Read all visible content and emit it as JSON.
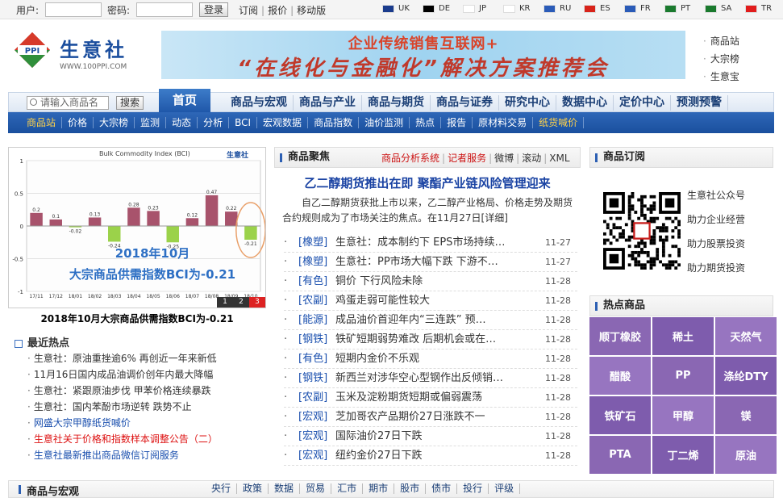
{
  "topbar": {
    "username_label": "用户:",
    "password_label": "密码:",
    "login_button": "登录",
    "links": [
      "订阅",
      "报价",
      "移动版"
    ],
    "languages": [
      {
        "code": "UK",
        "flag_color": "#1a3b8c"
      },
      {
        "code": "DE",
        "flag_color": "#000000"
      },
      {
        "code": "JP",
        "flag_color": "#ffffff"
      },
      {
        "code": "KR",
        "flag_color": "#ffffff"
      },
      {
        "code": "RU",
        "flag_color": "#2a5bb8"
      },
      {
        "code": "ES",
        "flag_color": "#d8231a"
      },
      {
        "code": "FR",
        "flag_color": "#2a5bb8"
      },
      {
        "code": "PT",
        "flag_color": "#1a7a2e"
      },
      {
        "code": "SA",
        "flag_color": "#1a7a2e"
      },
      {
        "code": "TR",
        "flag_color": "#e11c1c"
      }
    ]
  },
  "logo": {
    "name": "生意社",
    "url": "WWW.100PPI.COM",
    "mark": "PPI"
  },
  "banner": {
    "line1": "企业传统销售互联网+",
    "line2": "“在线化与金融化”解决方案推荐会"
  },
  "right_links": [
    "商品站",
    "大宗榜",
    "生意宝"
  ],
  "search": {
    "placeholder": "请输入商品名",
    "button": "搜索"
  },
  "main_nav": {
    "home": "首页",
    "items": [
      "商品与宏观",
      "商品与产业",
      "商品与期货",
      "商品与证券",
      "研究中心",
      "数据中心",
      "定价中心",
      "预测预警"
    ]
  },
  "sub_nav": {
    "items": [
      "商品站",
      "价格",
      "大宗榜",
      "监测",
      "动态",
      "分析",
      "BCI",
      "宏观数据",
      "商品指数",
      "油价监测",
      "热点",
      "报告",
      "原材料交易",
      "纸货喊价"
    ],
    "highlighted": [
      "商品站",
      "纸货喊价"
    ]
  },
  "chart_data": {
    "type": "bar",
    "title": "Bulk Commodity Index (BCI)",
    "categories": [
      "17/11",
      "17/12",
      "18/01",
      "18/02",
      "18/03",
      "18/04",
      "18/05",
      "18/06",
      "18/07",
      "18/08",
      "18/09",
      "18/10"
    ],
    "values": [
      0.2,
      0.1,
      -0.02,
      0.13,
      -0.24,
      0.28,
      0.23,
      -0.25,
      0.12,
      0.47,
      0.22,
      -0.21
    ],
    "ylim": [
      -1,
      1
    ],
    "yticks": [
      1,
      0.5,
      0,
      -0.5,
      -1
    ],
    "overlay_text": [
      "2018年10月",
      "大宗商品供需指数BCI为-0.21"
    ],
    "pages": [
      "1",
      "2",
      "3"
    ],
    "active_page": "3",
    "pos_color": "#a8536c",
    "neg_color": "#9bd24a"
  },
  "chart_caption": "2018年10月大宗商品供需指数BCI为-0.21",
  "hot": {
    "title": "最近热点",
    "items": [
      {
        "text": "生意社：原油重挫逾6% 再创近一年来新低",
        "style": "normal"
      },
      {
        "text": "11月16日国内成品油调价创年内最大降幅",
        "style": "normal"
      },
      {
        "text": "生意社：紧跟原油步伐 甲苯价格连续暴跌",
        "style": "normal"
      },
      {
        "text": "生意社：国内苯酚市场逆转 跌势不止",
        "style": "normal"
      },
      {
        "text": "网盛大宗甲醇纸货喊价",
        "style": "blue"
      },
      {
        "text": "生意社关于价格和指数样本调整公告（二）",
        "style": "red"
      },
      {
        "text": "生意社最新推出商品微信订阅服务",
        "style": "blue"
      }
    ]
  },
  "focus": {
    "title": "商品聚焦",
    "links": [
      "商品分析系统",
      "记者服务",
      "微博",
      "滚动",
      "XML"
    ],
    "headline": "乙二醇期货推出在即 聚酯产业链风险管理迎来",
    "summary": "自乙二醇期货获批上市以来，乙二醇产业格局、价格走势及期货合约规则成为了市场关注的焦点。在11月27日[详细]",
    "news": [
      {
        "tag": "[橡塑]",
        "title": "生意社：成本制约下 EPS市场持续…",
        "date": "11-27"
      },
      {
        "tag": "[橡塑]",
        "title": "生意社：PP市场大幅下跌 下游不…",
        "date": "11-27"
      },
      {
        "tag": "[有色]",
        "title": "铜价 下行风险未除",
        "date": "11-28"
      },
      {
        "tag": "[农副]",
        "title": "鸡蛋走弱可能性较大",
        "date": "11-28"
      },
      {
        "tag": "[能源]",
        "title": "成品油价首迎年内“三连跌” 预…",
        "date": "11-28"
      },
      {
        "tag": "[钢铁]",
        "title": "铁矿短期弱势难改 后期机会或在…",
        "date": "11-28"
      },
      {
        "tag": "[有色]",
        "title": "短期内金价不乐观",
        "date": "11-28"
      },
      {
        "tag": "[钢铁]",
        "title": "新西兰对涉华空心型钢作出反倾销…",
        "date": "11-28"
      },
      {
        "tag": "[农副]",
        "title": "玉米及淀粉期货短期或偏弱震荡",
        "date": "11-28"
      },
      {
        "tag": "[宏观]",
        "title": "芝加哥农产品期价27日涨跌不一",
        "date": "11-28"
      },
      {
        "tag": "[宏观]",
        "title": "国际油价27日下跌",
        "date": "11-28"
      },
      {
        "tag": "[宏观]",
        "title": "纽约金价27日下跌",
        "date": "11-28"
      }
    ]
  },
  "subscribe": {
    "title": "商品订阅",
    "lines": [
      "生意社公众号",
      "助力企业经营",
      "助力股票投资",
      "助力期货投资"
    ]
  },
  "hot_goods": {
    "title": "热点商品",
    "tiles": [
      {
        "label": "顺丁橡胶",
        "color": "#8a67b3"
      },
      {
        "label": "稀土",
        "color": "#7e5cad"
      },
      {
        "label": "天然气",
        "color": "#9775c0"
      },
      {
        "label": "醋酸",
        "color": "#9775c0"
      },
      {
        "label": "PP",
        "color": "#8a67b3"
      },
      {
        "label": "涤纶DTY",
        "color": "#7e5cad"
      },
      {
        "label": "铁矿石",
        "color": "#7e5cad"
      },
      {
        "label": "甲醇",
        "color": "#9775c0"
      },
      {
        "label": "镁",
        "color": "#8a67b3"
      },
      {
        "label": "PTA",
        "color": "#8a67b3"
      },
      {
        "label": "丁二烯",
        "color": "#7e5cad"
      },
      {
        "label": "原油",
        "color": "#9775c0"
      }
    ]
  },
  "bottom": {
    "title": "商品与宏观",
    "links": [
      "央行",
      "政策",
      "数据",
      "贸易",
      "汇市",
      "期市",
      "股市",
      "债市",
      "投行",
      "评级"
    ]
  }
}
